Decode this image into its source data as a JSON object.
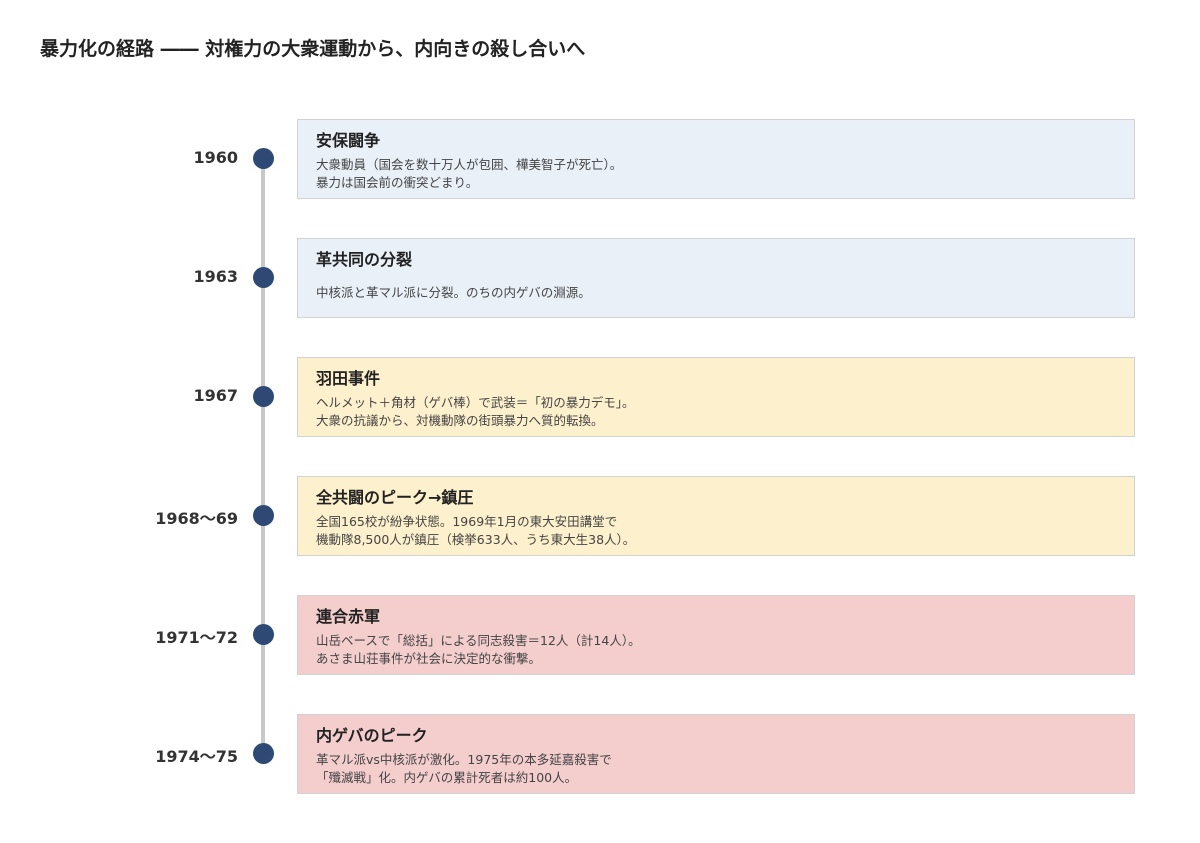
{
  "title": "暴力化の経路 ―― 対権力の大衆運動から、内向きの殺し合いへ",
  "colors": {
    "blue_card": "#e9f0f8",
    "yellow_card": "#fdf0cc",
    "red_card": "#f4cdcd",
    "dot": "#2e4a74",
    "line": "#c8c8c8"
  },
  "events": [
    {
      "year": "1960",
      "title": "安保闘争",
      "lines": [
        "大衆動員（国会を数十万人が包囲、樺美智子が死亡）。",
        "暴力は国会前の衝突どまり。"
      ],
      "color": "#e9f0f8"
    },
    {
      "year": "1963",
      "title": "革共同の分裂",
      "lines": [
        "中核派と革マル派に分裂。のちの内ゲバの淵源。"
      ],
      "color": "#e9f0f8"
    },
    {
      "year": "1967",
      "title": "羽田事件",
      "lines": [
        "ヘルメット＋角材（ゲバ棒）で武装＝「初の暴力デモ」。",
        "大衆の抗議から、対機動隊の街頭暴力へ質的転換。"
      ],
      "color": "#fdf0cc"
    },
    {
      "year": "1968〜69",
      "title": "全共闘のピーク→鎮圧",
      "lines": [
        "全国165校が紛争状態。1969年1月の東大安田講堂で",
        "機動隊8,500人が鎮圧（検挙633人、うち東大生38人）。"
      ],
      "color": "#fdf0cc"
    },
    {
      "year": "1971〜72",
      "title": "連合赤軍",
      "lines": [
        "山岳ベースで「総括」による同志殺害＝12人（計14人）。",
        "あさま山荘事件が社会に決定的な衝撃。"
      ],
      "color": "#f4cdcd"
    },
    {
      "year": "1974〜75",
      "title": "内ゲバのピーク",
      "lines": [
        "革マル派vs中核派が激化。1975年の本多延嘉殺害で",
        "「殲滅戦」化。内ゲバの累計死者は約100人。"
      ],
      "color": "#f4cdcd"
    }
  ]
}
